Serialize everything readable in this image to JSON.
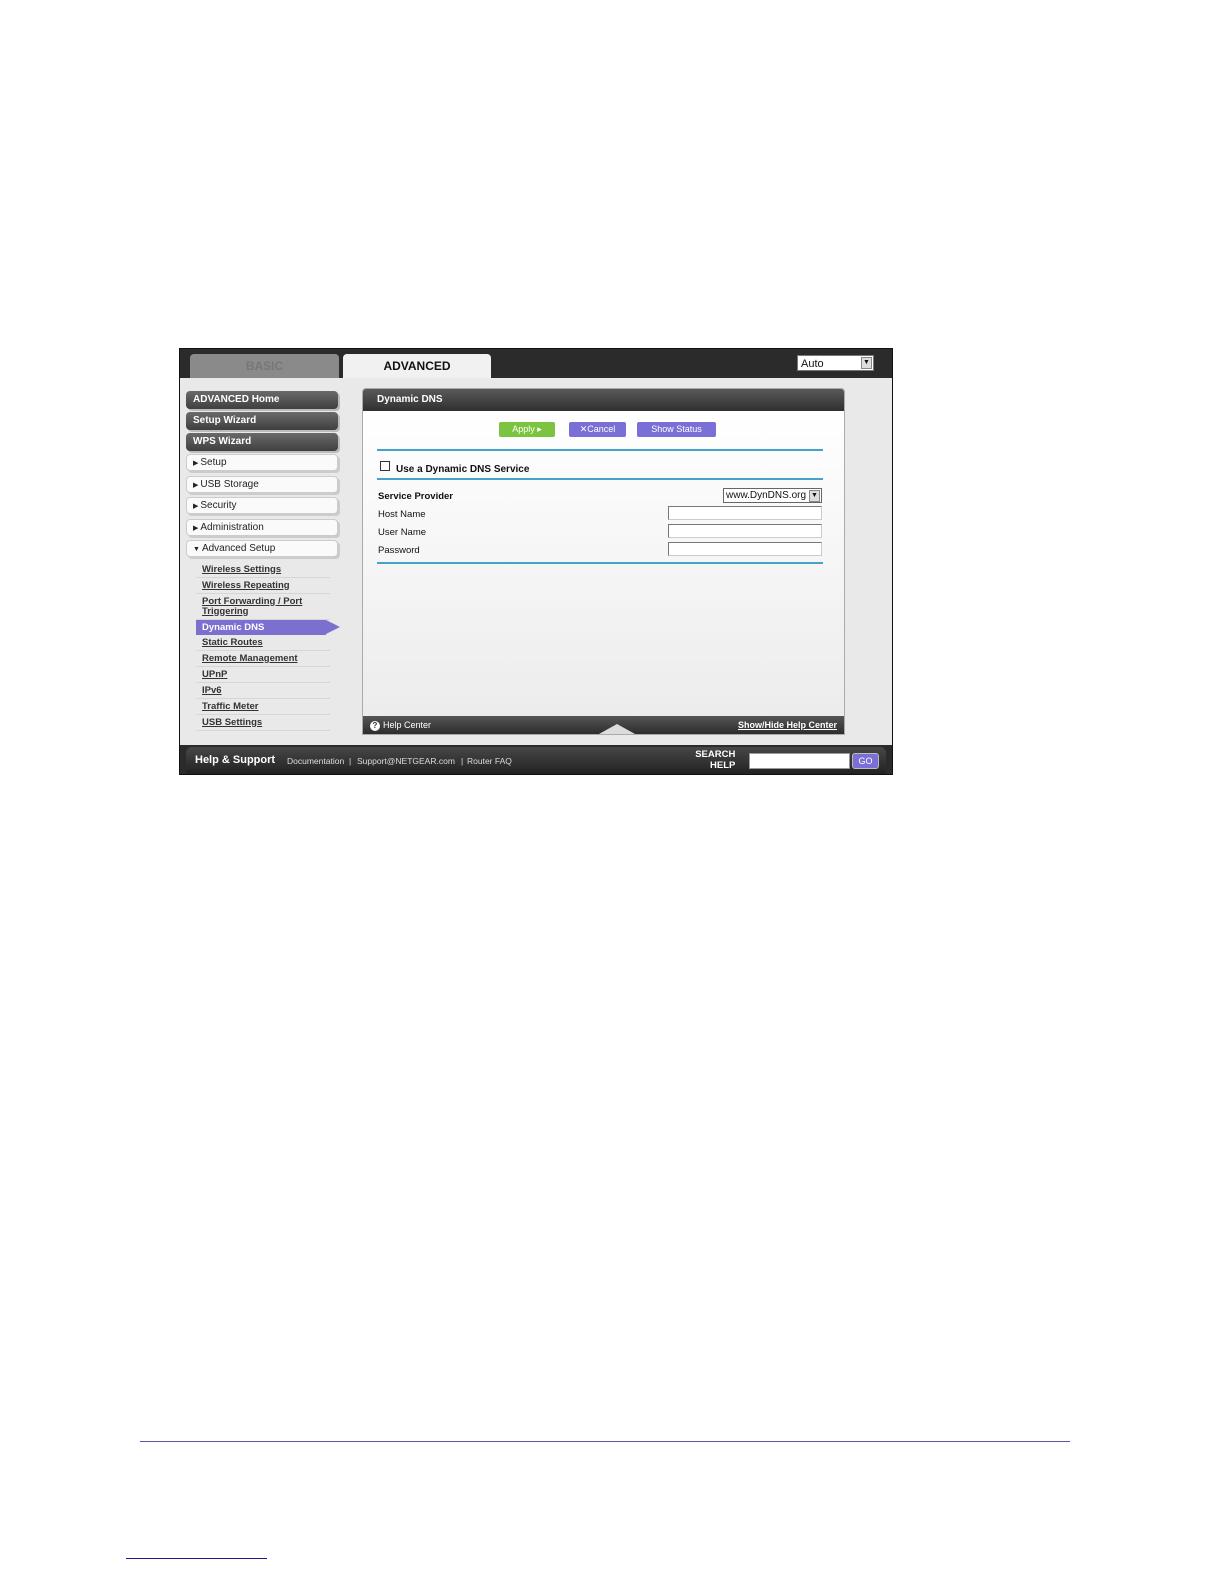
{
  "tabs": {
    "basic": "BASIC",
    "advanced": "ADVANCED"
  },
  "language": {
    "selected": "Auto"
  },
  "sidebar": {
    "dark_items": [
      {
        "label": "ADVANCED Home"
      },
      {
        "label": "Setup Wizard"
      },
      {
        "label": "WPS Wizard"
      }
    ],
    "light_items": [
      {
        "label": "Setup"
      },
      {
        "label": "USB Storage"
      },
      {
        "label": "Security"
      },
      {
        "label": "Administration"
      },
      {
        "label": "Advanced Setup"
      }
    ],
    "sub_items": [
      {
        "label": "Wireless Settings"
      },
      {
        "label": "Wireless Repeating"
      },
      {
        "label": "Port Forwarding / Port Triggering"
      },
      {
        "label": "Dynamic DNS"
      },
      {
        "label": "Static Routes"
      },
      {
        "label": "Remote Management"
      },
      {
        "label": "UPnP"
      },
      {
        "label": "IPv6"
      },
      {
        "label": "Traffic Meter"
      },
      {
        "label": "USB Settings"
      }
    ]
  },
  "panel": {
    "title": "Dynamic DNS",
    "apply": "Apply",
    "cancel": "Cancel",
    "show_status": "Show Status",
    "use_ddns": "Use a Dynamic DNS Service",
    "service_provider_label": "Service Provider",
    "service_provider_value": "www.DynDNS.org",
    "host_name_label": "Host Name",
    "user_name_label": "User Name",
    "password_label": "Password",
    "help_center": "Help Center",
    "show_hide": "Show/Hide Help Center"
  },
  "support": {
    "title": "Help & Support",
    "documentation": "Documentation",
    "support_email": "Support@NETGEAR.com",
    "router_faq": "Router FAQ",
    "search_label_1": "SEARCH",
    "search_label_2": "HELP",
    "go": "GO"
  }
}
